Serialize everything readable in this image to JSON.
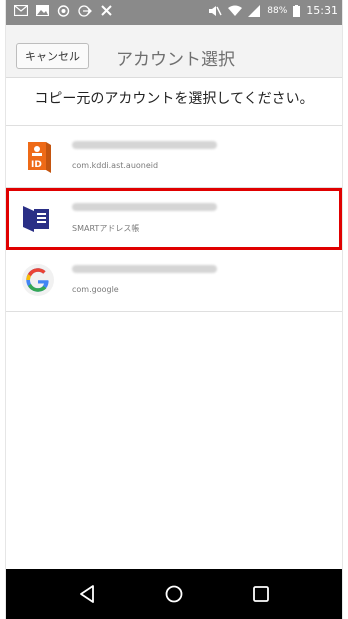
{
  "status_bar": {
    "battery": "88%",
    "time": "15:31",
    "left_icons": [
      "gmail-icon",
      "gallery-icon",
      "wellness-icon",
      "login-icon",
      "tools-icon"
    ],
    "right_icons": [
      "mute-icon",
      "wifi-icon",
      "signal-icon",
      "battery-icon"
    ]
  },
  "header": {
    "cancel_label": "キャンセル",
    "title": "アカウント選択"
  },
  "prompt": "コピー元のアカウントを選択してください。",
  "accounts": [
    {
      "icon": "au-id-icon",
      "account_name": "",
      "subtitle": "com.kddi.ast.auoneid",
      "selected": false
    },
    {
      "icon": "smart-address-book-icon",
      "account_name": "",
      "subtitle": "SMARTアドレス帳",
      "selected": true
    },
    {
      "icon": "google-icon",
      "account_name": "",
      "subtitle": "com.google",
      "selected": false
    }
  ],
  "colors": {
    "selection": "#e00000",
    "status_bar": "#8a8a8a",
    "nav_bar": "#000000"
  }
}
